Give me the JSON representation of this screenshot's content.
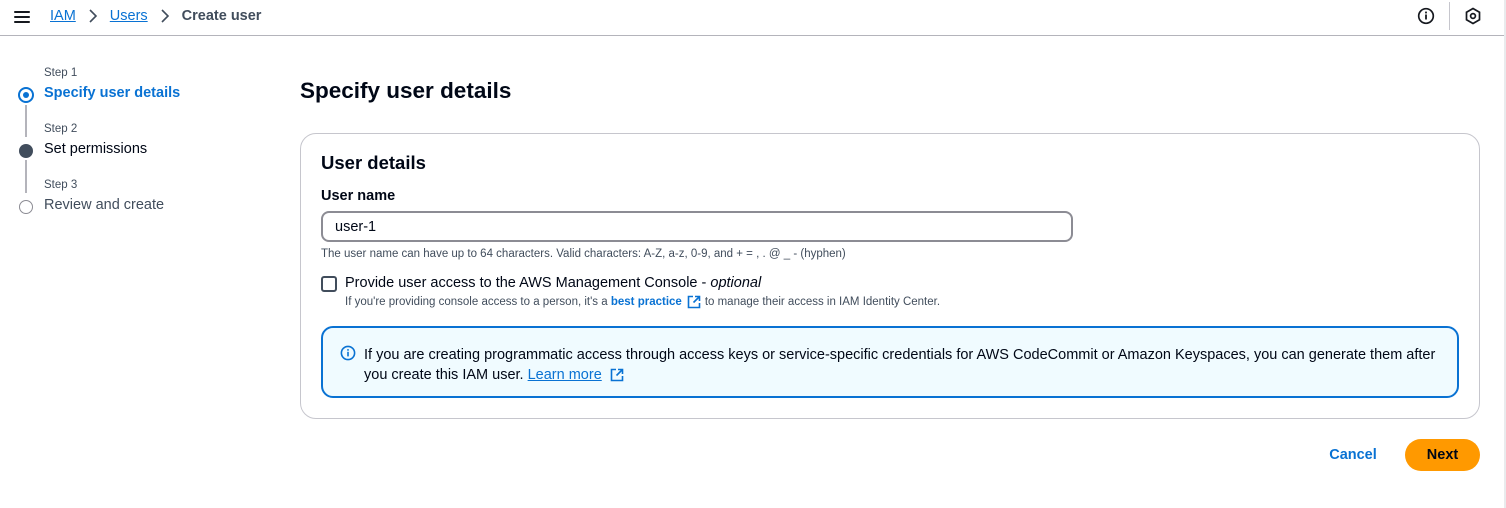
{
  "breadcrumb": {
    "items": [
      "IAM",
      "Users"
    ],
    "current": "Create user"
  },
  "steps": [
    {
      "label": "Step 1",
      "title": "Specify user details",
      "state": "active"
    },
    {
      "label": "Step 2",
      "title": "Set permissions",
      "state": "filled"
    },
    {
      "label": "Step 3",
      "title": "Review and create",
      "state": "empty"
    }
  ],
  "main": {
    "page_title": "Specify user details",
    "container_title": "User details",
    "username_label": "User name",
    "username_value": "user-1",
    "username_constraint": "The user name can have up to 64 characters. Valid characters: A-Z, a-z, 0-9, and + = , . @ _ - (hyphen)",
    "console_access_label": "Provide user access to the AWS Management Console - ",
    "console_access_optional": "optional",
    "console_access_checked": false,
    "console_desc_before": "If you're providing console access to a person, it's a ",
    "console_desc_link": "best practice",
    "console_desc_after": " to manage their access in IAM Identity Center.",
    "alert_text": "If you are creating programmatic access through access keys or service-specific credentials for AWS CodeCommit or Amazon Keyspaces, you can generate them after you create this IAM user. ",
    "alert_link": "Learn more"
  },
  "actions": {
    "cancel_label": "Cancel",
    "next_label": "Next"
  },
  "colors": {
    "link": "#0972d3",
    "primary_button": "#ff9900",
    "alert_background": "#f0fbff",
    "alert_border": "#0972d3"
  },
  "icons": [
    "menu-icon",
    "chevron-right-icon",
    "info-icon",
    "settings-hexagon-icon",
    "external-link-icon"
  ]
}
